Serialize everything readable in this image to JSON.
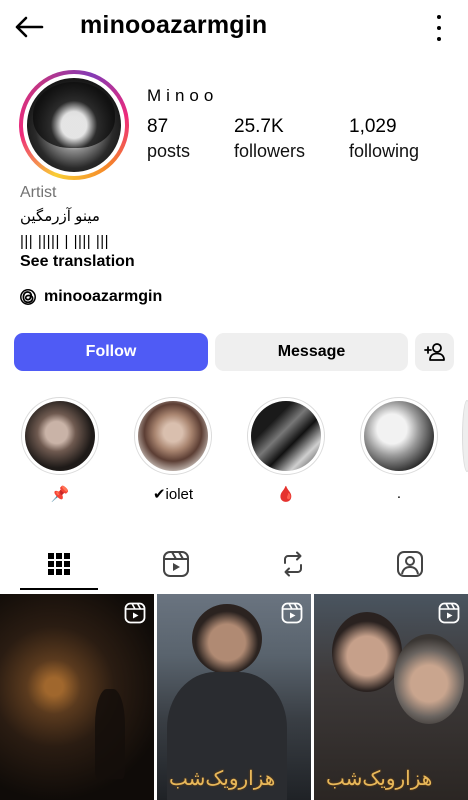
{
  "header": {
    "username": "minooazarmgin",
    "back_icon": "arrow-left-icon",
    "more_icon": "more-vertical-icon"
  },
  "profile": {
    "display_name": "Minoo",
    "stats": {
      "posts_count": "87",
      "posts_label": "posts",
      "followers_count": "25.7K",
      "followers_label": "followers",
      "following_count": "1,029",
      "following_label": "following"
    },
    "category": "Artist",
    "bio_line1": "مینو آزرمگین",
    "bio_line2": "||| ||||| | |||| |||",
    "see_translation": "See translation",
    "threads_handle": "minooazarmgin"
  },
  "actions": {
    "follow_label": "Follow",
    "message_label": "Message",
    "add_user_icon": "add-person-icon"
  },
  "highlights": [
    {
      "label": "📌"
    },
    {
      "label": "✔iolet"
    },
    {
      "label": "🩸"
    },
    {
      "label": "."
    }
  ],
  "tabs": [
    {
      "icon": "grid-icon",
      "active": true
    },
    {
      "icon": "reels-icon",
      "active": false
    },
    {
      "icon": "repost-icon",
      "active": false
    },
    {
      "icon": "tagged-icon",
      "active": false
    }
  ],
  "posts": [
    {
      "type": "reel",
      "caption": ""
    },
    {
      "type": "reel",
      "caption": "هزارویک‌شب"
    },
    {
      "type": "reel",
      "caption": "هزارویک‌شب"
    }
  ],
  "colors": {
    "follow_button": "#4f5bf5",
    "secondary_button": "#efefef",
    "muted_text": "#737373"
  }
}
